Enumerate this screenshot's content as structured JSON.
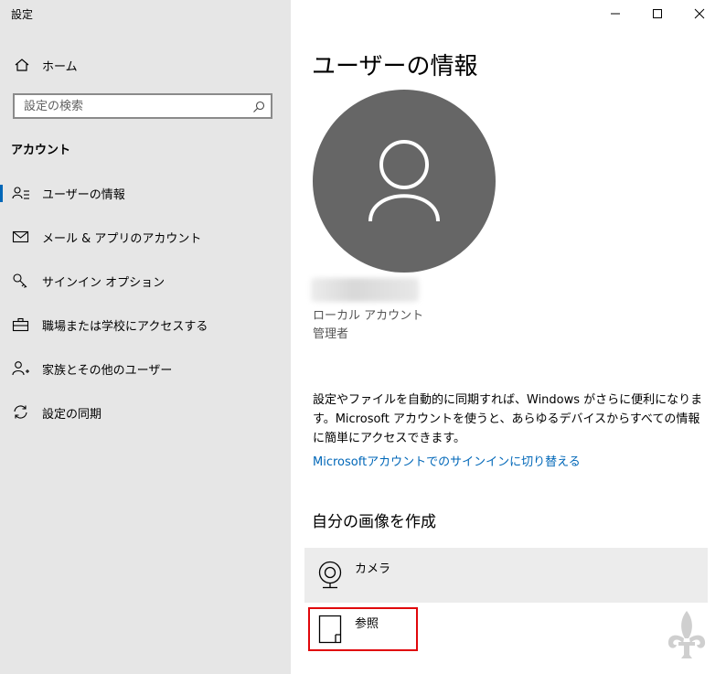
{
  "window": {
    "title": "設定",
    "controls": {
      "minimize": "minimize-icon",
      "maximize": "maximize-icon",
      "close": "close-icon"
    }
  },
  "sidebar": {
    "home_label": "ホーム",
    "search_placeholder": "設定の検索",
    "section_title": "アカウント",
    "items": [
      {
        "label": "ユーザーの情報",
        "icon": "user-info-icon",
        "active": true
      },
      {
        "label": "メール & アプリのアカウント",
        "icon": "mail-icon",
        "active": false
      },
      {
        "label": "サインイン オプション",
        "icon": "key-icon",
        "active": false
      },
      {
        "label": "職場または学校にアクセスする",
        "icon": "briefcase-icon",
        "active": false
      },
      {
        "label": "家族とその他のユーザー",
        "icon": "add-person-icon",
        "active": false
      },
      {
        "label": "設定の同期",
        "icon": "sync-icon",
        "active": false
      }
    ]
  },
  "main": {
    "title": "ユーザーの情報",
    "account_type": "ローカル アカウント",
    "account_role": "管理者",
    "description": "設定やファイルを自動的に同期すれば、Windows がさらに便利になります。Microsoft アカウントを使うと、あらゆるデバイスからすべての情報に簡単にアクセスできます。",
    "switch_link": "Microsoftアカウントでのサインインに切り替える",
    "create_picture_title": "自分の画像を作成",
    "options": [
      {
        "label": "カメラ",
        "icon": "camera-icon"
      },
      {
        "label": "参照",
        "icon": "browse-icon"
      }
    ]
  },
  "colors": {
    "accent": "#0067b8",
    "sidebar_bg": "#e6e6e6",
    "avatar_bg": "#666666",
    "highlight": "#e0060b"
  }
}
